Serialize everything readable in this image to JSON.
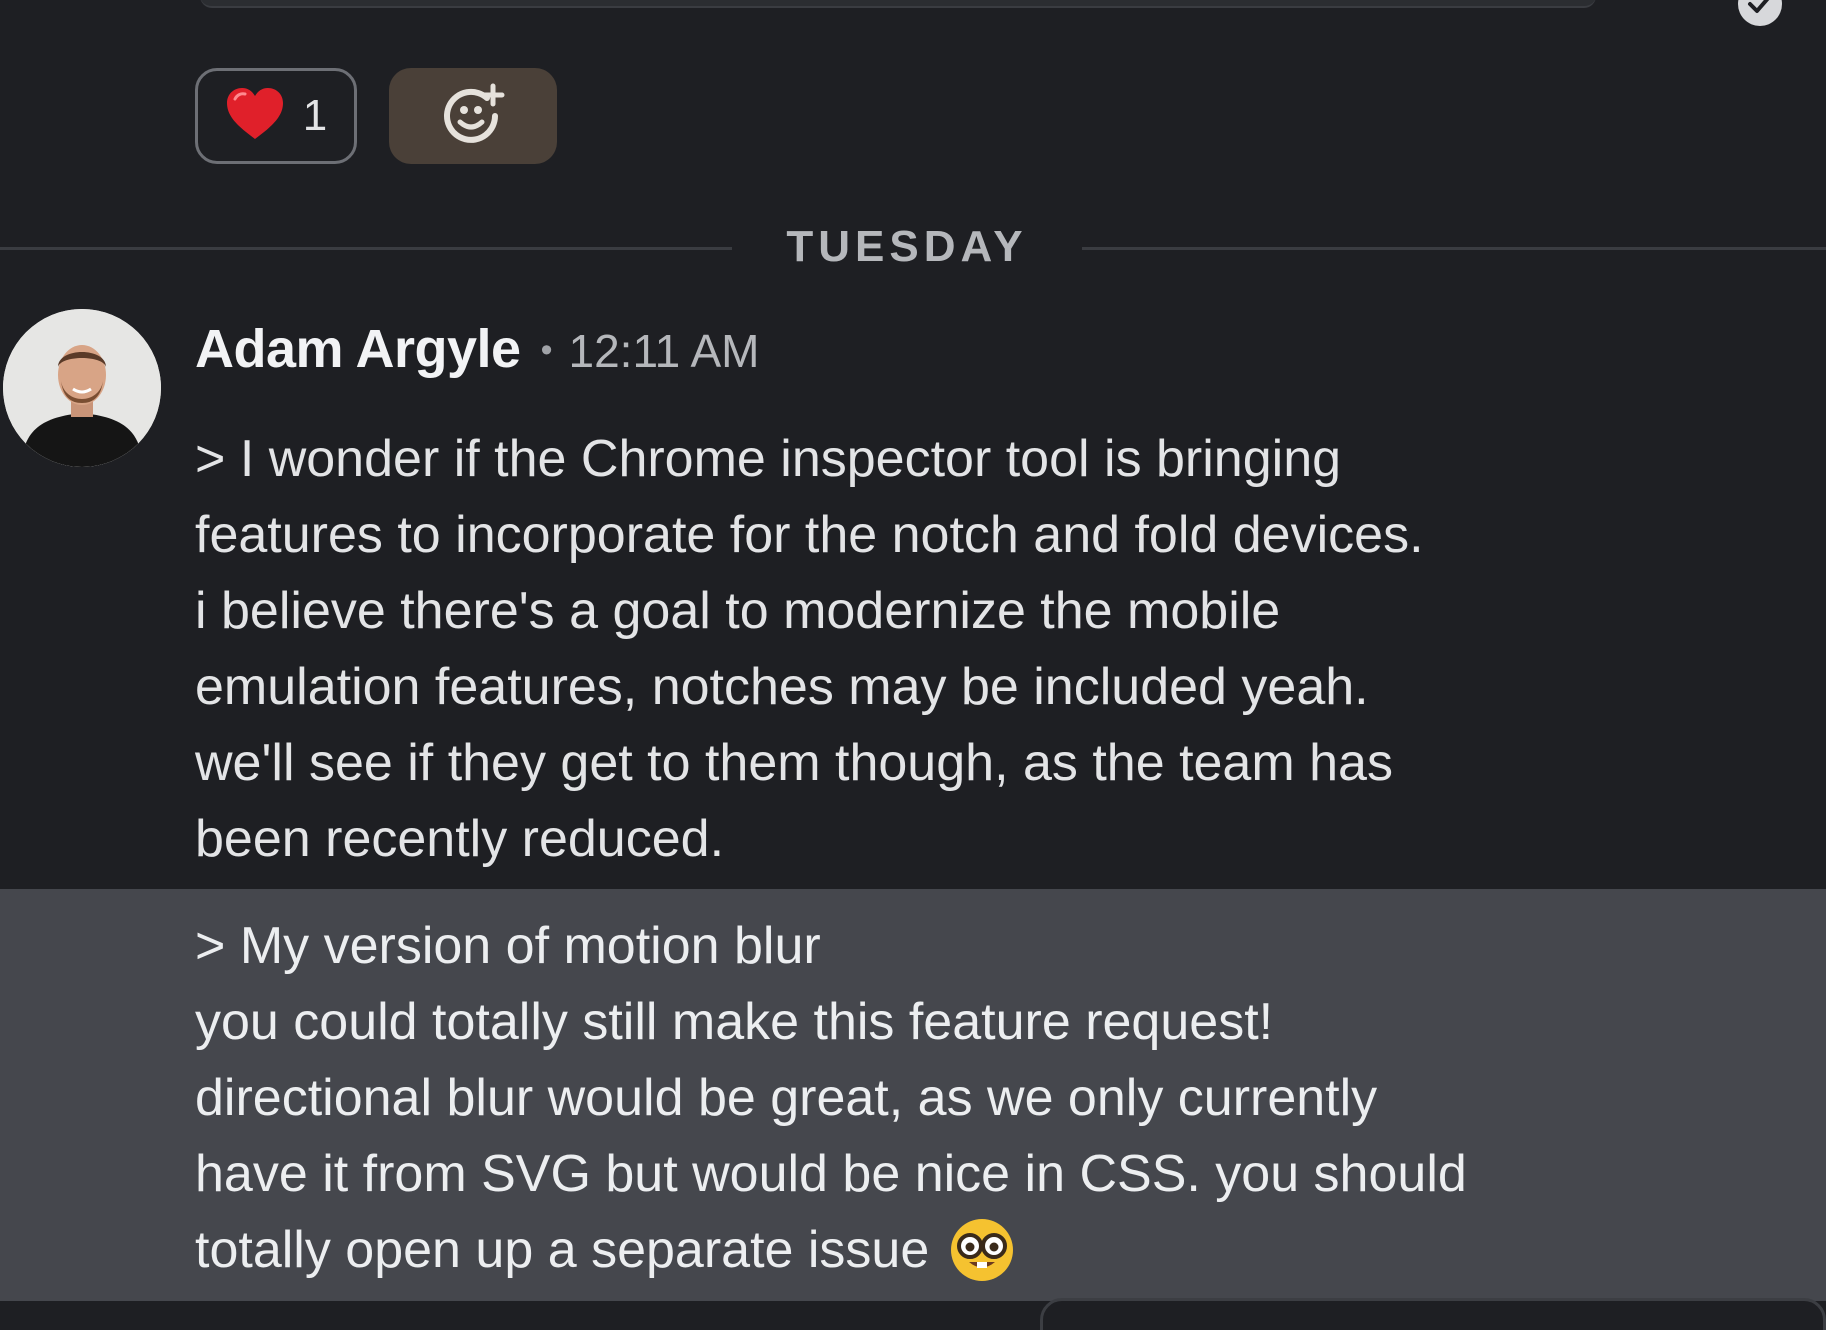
{
  "reactions": {
    "heart": {
      "emoji_icon": "red-heart-icon",
      "count": "1"
    },
    "add": {
      "icon": "add-reaction-smiley-icon",
      "accent": "#4a4038"
    }
  },
  "divider": {
    "label": "TUESDAY"
  },
  "message": {
    "author": "Adam Argyle",
    "separator": "•",
    "time": "12:11 AM",
    "lines": [
      "> I wonder if the Chrome inspector tool is bringing",
      "features to incorporate for the notch and fold devices.",
      "i believe there's a goal to modernize the mobile",
      "emulation features, notches may be included yeah.",
      "we'll see if they get to them though, as the team has",
      "been recently reduced."
    ]
  },
  "followup": {
    "lines": [
      "> My version of motion blur",
      "you could totally still make this feature request!",
      "directional blur would be great, as we only currently",
      "have it from SVG but would be nice in CSS. you should",
      "totally open up a separate issue"
    ],
    "trailing_emoji": "nerd-face-icon"
  },
  "colors": {
    "background": "#1e1f23",
    "hover_row": "#45474d",
    "text": "#e3e4e6",
    "muted": "#b5b7bb"
  }
}
